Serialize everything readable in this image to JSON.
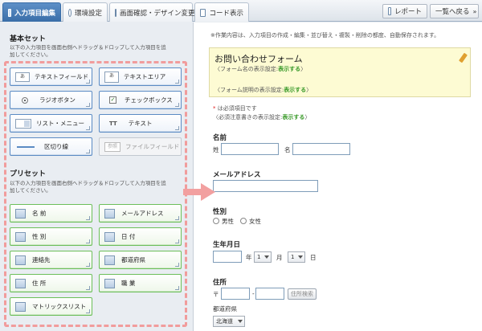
{
  "tabs": [
    {
      "label": "入力項目編集",
      "active": true
    },
    {
      "label": "環境設定"
    },
    {
      "label": "画面確認・デザイン変更"
    },
    {
      "label": "コード表示"
    }
  ],
  "toolbar": {
    "report_label": "レポート",
    "back_label": "一覧へ戻る"
  },
  "basic_set": {
    "title": "基本セット",
    "desc": "以下の入力項目を画面右側へドラッグ＆ドロップして入力項目を追加してください。",
    "items": [
      {
        "label": "テキストフィールド",
        "icon": "text-field-icon",
        "icon_text": "あ"
      },
      {
        "label": "テキストエリア",
        "icon": "text-area-icon",
        "icon_text": "あ"
      },
      {
        "label": "ラジオボタン",
        "icon": "radio-icon"
      },
      {
        "label": "チェックボックス",
        "icon": "checkbox-icon"
      },
      {
        "label": "リスト・メニュー",
        "icon": "list-menu-icon"
      },
      {
        "label": "テキスト",
        "icon": "text-icon",
        "icon_text": "TT"
      },
      {
        "label": "区切り線",
        "icon": "separator-icon"
      },
      {
        "label": "ファイルフィールド",
        "icon": "file-field-icon",
        "icon_text": "参照"
      }
    ]
  },
  "preset": {
    "title": "プリセット",
    "desc": "以下の入力項目を画面右側へドラッグ＆ドロップして入力項目を追加してください。",
    "items": [
      {
        "label": "名 前",
        "icon": "person-icon"
      },
      {
        "label": "メールアドレス",
        "icon": "mail-icon"
      },
      {
        "label": "性 別",
        "icon": "gender-icon"
      },
      {
        "label": "日 付",
        "icon": "calendar-icon"
      },
      {
        "label": "連絡先",
        "icon": "contact-icon"
      },
      {
        "label": "都道府県",
        "icon": "map-icon"
      },
      {
        "label": "住 所",
        "icon": "house-icon"
      },
      {
        "label": "職 業",
        "icon": "job-icon"
      },
      {
        "label": "マトリックスリスト",
        "icon": "matrix-icon"
      }
    ]
  },
  "preview": {
    "note": "※作業内容は、入力項目の作成・編集・並び替え・複製・削除の都度、自動保存されます。",
    "form_title": "お問い合わせフォーム",
    "form_name_line_prefix": "〈フォーム名の表示設定:",
    "form_desc_line_prefix": "〈フォーム説明の表示設定:",
    "display_label": "表示する",
    "line_suffix": "〉",
    "required_note_prefix": "は必須項目です",
    "required_mark": "*",
    "required_display_prefix": "〈必須注意書きの表示設定:",
    "fields": {
      "name_label": "名前",
      "sei": "姓",
      "mei": "名",
      "email_label": "メールアドレス",
      "gender_label": "性別",
      "male": "男性",
      "female": "女性",
      "birthday_label": "生年月日",
      "year": "年",
      "month": "月",
      "day": "日",
      "month_value": "1",
      "day_value": "1",
      "address_label": "住所",
      "postal_mark": "〒",
      "postal_sep": "-",
      "postal_search": "住所検索",
      "pref_label": "都道府県",
      "pref_value": "北海道"
    }
  }
}
